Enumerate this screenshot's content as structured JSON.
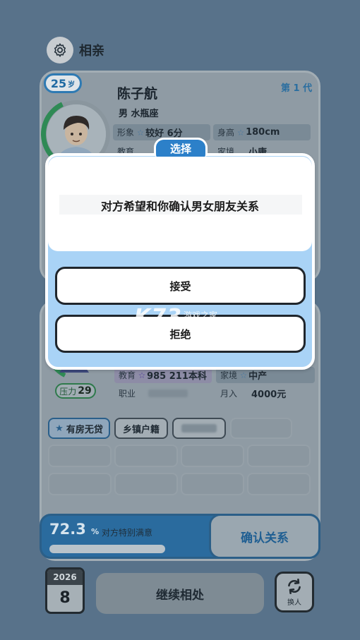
{
  "header": {
    "title": "相亲",
    "settings_icon": "gear-icon"
  },
  "profile": {
    "age": "25",
    "age_unit": "岁",
    "generation": "第 1 代",
    "name": "陈子航",
    "gender_sign": "男 水瓶座",
    "attributes": [
      {
        "key": "形象",
        "value": "较好 6分"
      },
      {
        "key": "身高",
        "value": "180cm"
      },
      {
        "key": "教育",
        "value": ""
      },
      {
        "key": "家境",
        "value": "小康"
      }
    ]
  },
  "player": {
    "pressure_label": "压力",
    "pressure_value": "29",
    "attributes": [
      {
        "key": "教育",
        "value": "985 211本科"
      },
      {
        "key": "家境",
        "value": "中产"
      },
      {
        "key": "职业",
        "value": ""
      },
      {
        "key": "月入",
        "value": "4000元"
      }
    ],
    "tags": [
      "有房无贷",
      "乡镇户籍"
    ]
  },
  "status": {
    "satisfaction": "72.3",
    "satisfaction_unit": "%",
    "satisfaction_text": "对方特别满意",
    "satisfaction_fraction": 0.723,
    "confirm_label": "确认关系"
  },
  "footer": {
    "year": "2026",
    "month": "8",
    "continue_label": "继续相处",
    "swap_label": "换人"
  },
  "dialog": {
    "tab_title": "选择",
    "message": "对方希望和你确认男女朋友关系",
    "accept_label": "接受",
    "reject_label": "拒绝"
  },
  "watermark": {
    "main": "K73",
    "cn": "游戏之家",
    "com": ".com"
  },
  "colors": {
    "accent": "#2c80c9",
    "modal_bg": "#a9d3f6",
    "page_bg": "#58728a",
    "good": "#2f8a55"
  }
}
